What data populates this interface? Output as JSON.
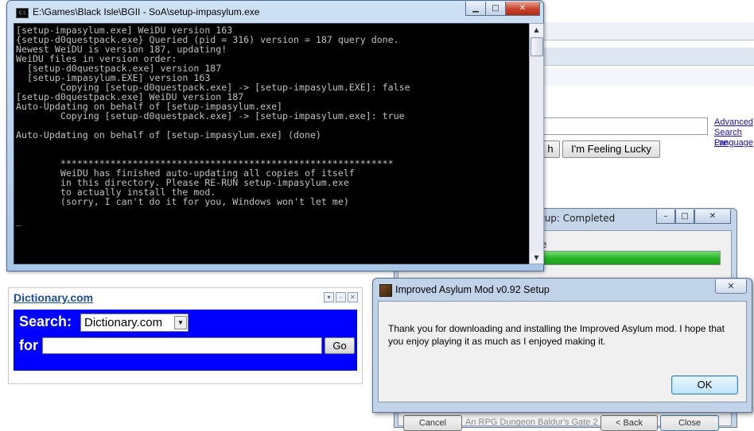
{
  "google": {
    "search_button": "h",
    "lucky_button": "I'm Feeling Lucky",
    "links": [
      "Advanced",
      "Search Pre",
      "Language"
    ]
  },
  "installer": {
    "title": "tup: Completed",
    "progress_prefix": "e",
    "progress_value": 1.0,
    "buttons": [
      "Cancel",
      "An RPG Dungeon Baldur's Gate 2",
      "< Back",
      "Close"
    ]
  },
  "dictionary": {
    "title": "Dictionary.com",
    "search_label": "Search:",
    "select_value": "Dictionary.com",
    "for_label": "for",
    "input_value": "",
    "go_button": "Go"
  },
  "console": {
    "title": "E:\\Games\\Black Isle\\BGII - SoA\\setup-impasylum.exe",
    "lines": [
      "[setup-impasylum.exe] WeiDU version 163",
      "{setup-d0questpack.exe} Queried (pid = 316) version = 187 query done.",
      "Newest WeiDU is version 187, updating!",
      "WeiDU files in version order:",
      "  [setup-d0questpack.exe] version 187",
      "  [setup-impasylum.EXE] version 163",
      "        Copying [setup-d0questpack.exe] -> [setup-impasylum.EXE]: false",
      "[setup-d0questpack.exe] WeiDU version 187",
      "Auto-Updating on behalf of [setup-impasylum.exe]",
      "        Copying [setup-d0questpack.exe] -> [setup-impasylum.exe]: true",
      "",
      "Auto-Updating on behalf of [setup-impasylum.exe] (done)",
      "",
      "",
      "        ************************************************************",
      "        WeiDU has finished auto-updating all copies of itself",
      "        in this directory. Please RE-RUN setup-impasylum.exe",
      "        to actually install the mod.",
      "        (sorry, I can't do it for you, Windows won't let me)",
      "",
      "_"
    ]
  },
  "dialog": {
    "title": "Improved Asylum Mod v0.92 Setup",
    "message": "Thank you for downloading and installing the Improved Asylum mod.  I hope that you enjoy playing it as much as I enjoyed making it.",
    "ok_button": "OK"
  },
  "colors": {
    "console_bg": "#000000",
    "console_text": "#c0c0c0",
    "dict_blue": "#0000ff",
    "progress_green": "#25b225"
  }
}
